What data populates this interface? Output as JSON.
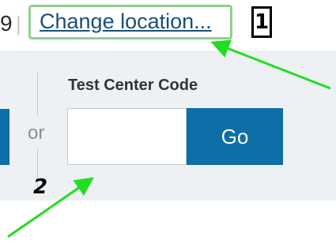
{
  "header": {
    "truncated_text": "9",
    "separator": "|",
    "change_location_label": "Change location..."
  },
  "annotations": {
    "badge_1": "1",
    "badge_2": "2",
    "arrow_color": "#22dd22"
  },
  "test_center": {
    "or_label": "or",
    "code_label": "Test Center Code",
    "code_value": "",
    "go_label": "Go"
  },
  "colors": {
    "primary": "#0e6ea8",
    "link": "#1a4f7a",
    "panel_bg": "#eef1f4",
    "highlight_border": "#8fd08f"
  }
}
